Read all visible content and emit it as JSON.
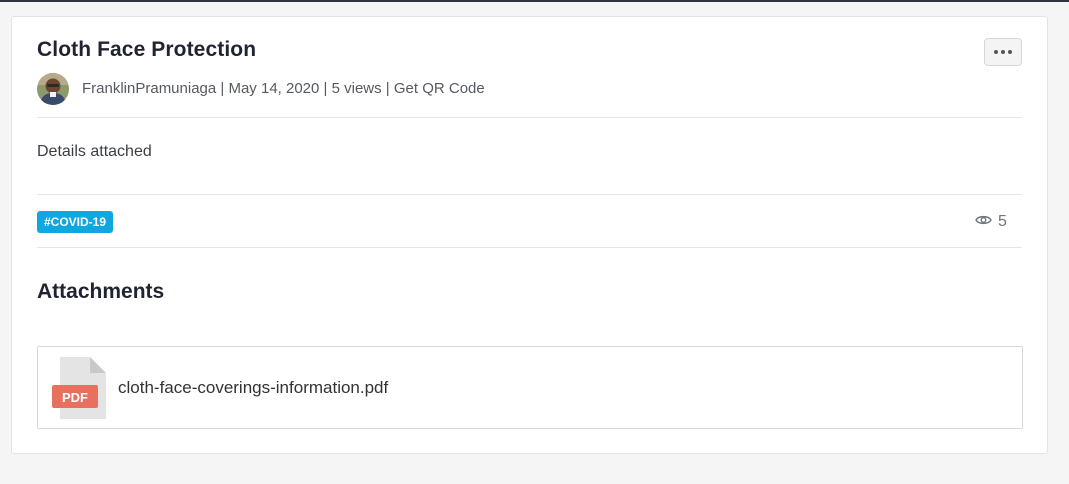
{
  "post": {
    "title": "Cloth Face Protection",
    "author": "FranklinPramuniaga",
    "date": "May 14, 2020",
    "views_text": "5 views",
    "qr_link": "Get QR Code",
    "separator": " | ",
    "body": "Details attached",
    "tag": "#COVID-19",
    "view_count": "5"
  },
  "attachments": {
    "heading": "Attachments",
    "file_name": "cloth-face-coverings-information.pdf",
    "file_badge": "PDF"
  },
  "icons": {
    "more": "more-horizontal-icon",
    "views": "eye-icon",
    "file": "pdf-file-icon"
  },
  "colors": {
    "tag_bg": "#10a7e0",
    "pdf_badge": "#e8705f"
  }
}
